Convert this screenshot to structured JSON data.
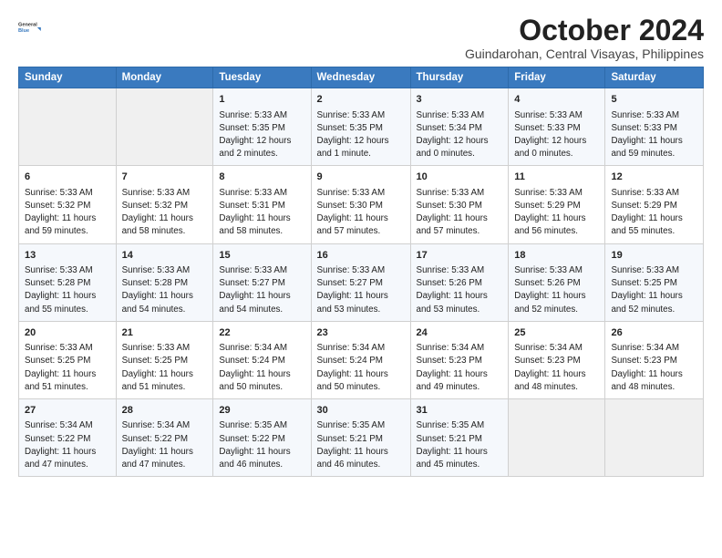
{
  "header": {
    "logo": {
      "line1": "General",
      "line2": "Blue"
    },
    "month": "October 2024",
    "location": "Guindarohan, Central Visayas, Philippines"
  },
  "columns": [
    "Sunday",
    "Monday",
    "Tuesday",
    "Wednesday",
    "Thursday",
    "Friday",
    "Saturday"
  ],
  "weeks": [
    [
      {
        "day": "",
        "info": ""
      },
      {
        "day": "",
        "info": ""
      },
      {
        "day": "1",
        "info": "Sunrise: 5:33 AM\nSunset: 5:35 PM\nDaylight: 12 hours\nand 2 minutes."
      },
      {
        "day": "2",
        "info": "Sunrise: 5:33 AM\nSunset: 5:35 PM\nDaylight: 12 hours\nand 1 minute."
      },
      {
        "day": "3",
        "info": "Sunrise: 5:33 AM\nSunset: 5:34 PM\nDaylight: 12 hours\nand 0 minutes."
      },
      {
        "day": "4",
        "info": "Sunrise: 5:33 AM\nSunset: 5:33 PM\nDaylight: 12 hours\nand 0 minutes."
      },
      {
        "day": "5",
        "info": "Sunrise: 5:33 AM\nSunset: 5:33 PM\nDaylight: 11 hours\nand 59 minutes."
      }
    ],
    [
      {
        "day": "6",
        "info": "Sunrise: 5:33 AM\nSunset: 5:32 PM\nDaylight: 11 hours\nand 59 minutes."
      },
      {
        "day": "7",
        "info": "Sunrise: 5:33 AM\nSunset: 5:32 PM\nDaylight: 11 hours\nand 58 minutes."
      },
      {
        "day": "8",
        "info": "Sunrise: 5:33 AM\nSunset: 5:31 PM\nDaylight: 11 hours\nand 58 minutes."
      },
      {
        "day": "9",
        "info": "Sunrise: 5:33 AM\nSunset: 5:30 PM\nDaylight: 11 hours\nand 57 minutes."
      },
      {
        "day": "10",
        "info": "Sunrise: 5:33 AM\nSunset: 5:30 PM\nDaylight: 11 hours\nand 57 minutes."
      },
      {
        "day": "11",
        "info": "Sunrise: 5:33 AM\nSunset: 5:29 PM\nDaylight: 11 hours\nand 56 minutes."
      },
      {
        "day": "12",
        "info": "Sunrise: 5:33 AM\nSunset: 5:29 PM\nDaylight: 11 hours\nand 55 minutes."
      }
    ],
    [
      {
        "day": "13",
        "info": "Sunrise: 5:33 AM\nSunset: 5:28 PM\nDaylight: 11 hours\nand 55 minutes."
      },
      {
        "day": "14",
        "info": "Sunrise: 5:33 AM\nSunset: 5:28 PM\nDaylight: 11 hours\nand 54 minutes."
      },
      {
        "day": "15",
        "info": "Sunrise: 5:33 AM\nSunset: 5:27 PM\nDaylight: 11 hours\nand 54 minutes."
      },
      {
        "day": "16",
        "info": "Sunrise: 5:33 AM\nSunset: 5:27 PM\nDaylight: 11 hours\nand 53 minutes."
      },
      {
        "day": "17",
        "info": "Sunrise: 5:33 AM\nSunset: 5:26 PM\nDaylight: 11 hours\nand 53 minutes."
      },
      {
        "day": "18",
        "info": "Sunrise: 5:33 AM\nSunset: 5:26 PM\nDaylight: 11 hours\nand 52 minutes."
      },
      {
        "day": "19",
        "info": "Sunrise: 5:33 AM\nSunset: 5:25 PM\nDaylight: 11 hours\nand 52 minutes."
      }
    ],
    [
      {
        "day": "20",
        "info": "Sunrise: 5:33 AM\nSunset: 5:25 PM\nDaylight: 11 hours\nand 51 minutes."
      },
      {
        "day": "21",
        "info": "Sunrise: 5:33 AM\nSunset: 5:25 PM\nDaylight: 11 hours\nand 51 minutes."
      },
      {
        "day": "22",
        "info": "Sunrise: 5:34 AM\nSunset: 5:24 PM\nDaylight: 11 hours\nand 50 minutes."
      },
      {
        "day": "23",
        "info": "Sunrise: 5:34 AM\nSunset: 5:24 PM\nDaylight: 11 hours\nand 50 minutes."
      },
      {
        "day": "24",
        "info": "Sunrise: 5:34 AM\nSunset: 5:23 PM\nDaylight: 11 hours\nand 49 minutes."
      },
      {
        "day": "25",
        "info": "Sunrise: 5:34 AM\nSunset: 5:23 PM\nDaylight: 11 hours\nand 48 minutes."
      },
      {
        "day": "26",
        "info": "Sunrise: 5:34 AM\nSunset: 5:23 PM\nDaylight: 11 hours\nand 48 minutes."
      }
    ],
    [
      {
        "day": "27",
        "info": "Sunrise: 5:34 AM\nSunset: 5:22 PM\nDaylight: 11 hours\nand 47 minutes."
      },
      {
        "day": "28",
        "info": "Sunrise: 5:34 AM\nSunset: 5:22 PM\nDaylight: 11 hours\nand 47 minutes."
      },
      {
        "day": "29",
        "info": "Sunrise: 5:35 AM\nSunset: 5:22 PM\nDaylight: 11 hours\nand 46 minutes."
      },
      {
        "day": "30",
        "info": "Sunrise: 5:35 AM\nSunset: 5:21 PM\nDaylight: 11 hours\nand 46 minutes."
      },
      {
        "day": "31",
        "info": "Sunrise: 5:35 AM\nSunset: 5:21 PM\nDaylight: 11 hours\nand 45 minutes."
      },
      {
        "day": "",
        "info": ""
      },
      {
        "day": "",
        "info": ""
      }
    ]
  ]
}
